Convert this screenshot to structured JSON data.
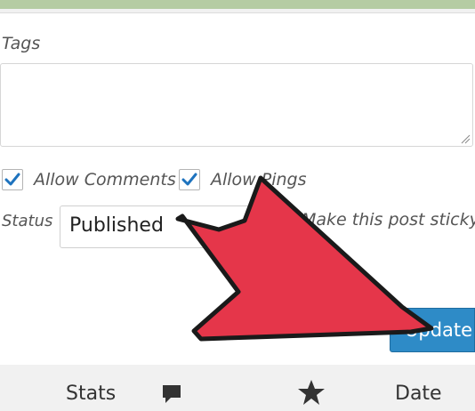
{
  "tags": {
    "label": "Tags",
    "value": ""
  },
  "options": {
    "allow_comments": {
      "label": "Allow Comments",
      "checked": true
    },
    "allow_pings": {
      "label": "Allow Pings",
      "checked": true
    }
  },
  "status": {
    "label": "Status",
    "selected": "Published"
  },
  "sticky": {
    "label": "Make this post sticky"
  },
  "update_button": {
    "label": "Update"
  },
  "bottom_nav": {
    "stats_label": "Stats",
    "comments_icon": "speech-bubble-icon",
    "likes_icon": "star-icon",
    "date_label": "Date"
  },
  "colors": {
    "accent": "#2e8bc7",
    "arrow": "#e5364a",
    "checkmark": "#1e73be"
  }
}
